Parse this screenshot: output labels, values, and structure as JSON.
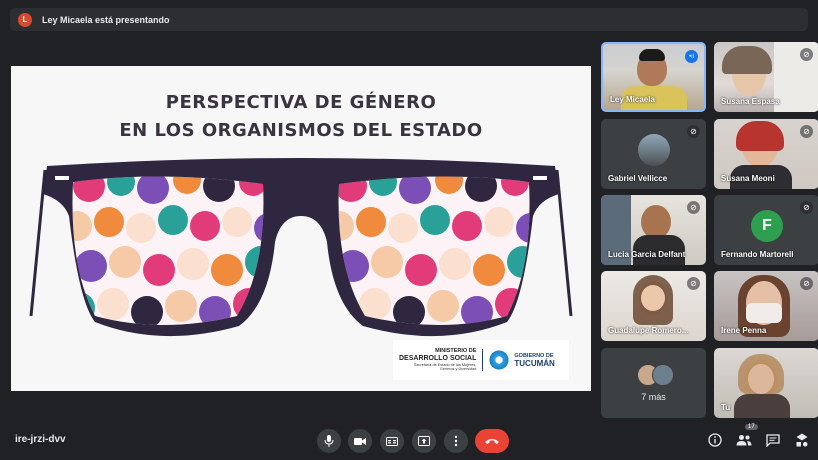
{
  "presenter": {
    "initial": "L",
    "text": "Ley Micaela está presentando"
  },
  "slide": {
    "title_line1": "PERSPECTIVA DE GÉNERO",
    "title_line2": "EN LOS ORGANISMOS DEL ESTADO",
    "logo": {
      "ministry_line1": "MINISTERIO DE",
      "ministry_line2": "DESARROLLO SOCIAL",
      "ministry_line3": "Secretaría de Estado de las Mujeres,",
      "ministry_line4": "Géneros y Diversidad",
      "gov_line1": "GOBIERNO DE",
      "gov_line2": "TUCUMÁN"
    },
    "colors": {
      "frame": "#2f2640",
      "accent_pink": "#e23b7a",
      "accent_teal": "#2aa198",
      "accent_orange": "#f08a3c",
      "accent_purple": "#7b4fb5"
    }
  },
  "participants": [
    {
      "name": "Ley Micaela",
      "mic": "speaking-icon"
    },
    {
      "name": "Susana Espasa",
      "mic": "mic-off-icon"
    },
    {
      "name": "Gabriel Vellicce",
      "mic": "mic-off-icon"
    },
    {
      "name": "Susana Meoni",
      "mic": "mic-off-icon"
    },
    {
      "name": "Lucia Garcia Delfant",
      "mic": "mic-off-icon"
    },
    {
      "name": "Fernando Martorell",
      "mic": "mic-off-icon",
      "initial": "F"
    },
    {
      "name": "Guadalupe Romero...",
      "mic": "mic-off-icon"
    },
    {
      "name": "Irene Penna",
      "mic": "mic-off-icon"
    },
    {
      "name": "Tu",
      "mic": "mic-off-icon"
    }
  ],
  "more": {
    "label": "7 más"
  },
  "bottom": {
    "meeting_code": "ire-jrzi-dvv",
    "participant_count": "17"
  }
}
